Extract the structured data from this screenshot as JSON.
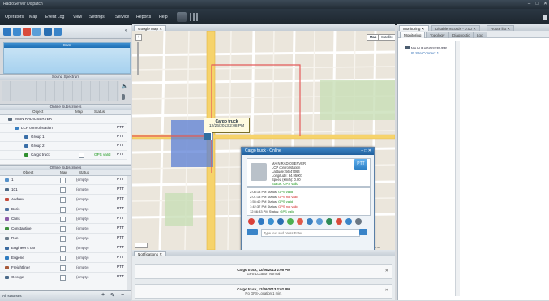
{
  "window": {
    "title": "RadioServer Dispatch"
  },
  "menu": [
    "Operators",
    "Map",
    "Event Log",
    "View",
    "Settings",
    "Service",
    "Reports",
    "Help"
  ],
  "panels": {
    "camera": "Cam",
    "spectrum": "Sound Spectrum",
    "online": "Online Subscribers",
    "offline": "Offline Subscribers"
  },
  "columns": {
    "object": "Object",
    "map": "Map",
    "status": "Status"
  },
  "online_rows": [
    {
      "name": "MAIN RADIOSERVER",
      "ptt": ""
    },
    {
      "name": "LCP control station",
      "ptt": "PTT"
    },
    {
      "name": "Group 1",
      "ptt": "PTT"
    },
    {
      "name": "Group 2",
      "ptt": "PTT"
    },
    {
      "name": "Cargo truck",
      "status": "GPS valid",
      "ptt": "PTT"
    }
  ],
  "offline_rows": [
    {
      "name": "1",
      "status": "(empty)",
      "ptt": "PTT"
    },
    {
      "name": "101",
      "status": "(empty)",
      "ptt": "PTT"
    },
    {
      "name": "Andrew",
      "status": "(empty)",
      "ptt": "PTT"
    },
    {
      "name": "Boris",
      "status": "(empty)",
      "ptt": "PTT"
    },
    {
      "name": "Chris",
      "status": "(empty)",
      "ptt": "PTT"
    },
    {
      "name": "Constantine",
      "status": "(empty)",
      "ptt": "PTT"
    },
    {
      "name": "Dan",
      "status": "(empty)",
      "ptt": "PTT"
    },
    {
      "name": "Engineer's car",
      "status": "(empty)",
      "ptt": "PTT"
    },
    {
      "name": "Eugene",
      "status": "(empty)",
      "ptt": "PTT"
    },
    {
      "name": "Freightliner",
      "status": "(empty)",
      "ptt": "PTT"
    },
    {
      "name": "George",
      "status": "(empty)",
      "ptt": "PTT"
    }
  ],
  "bottom": {
    "filter": "All statuses"
  },
  "map": {
    "tab": "Google Map",
    "type_map": "Map",
    "type_satellite": "Satellite",
    "tooltip_title": "Cargo truck",
    "tooltip_time": "12/26/2013 2:08 PM",
    "copyright": "Map data ©2013 Google · Terms of Use · Report a map error"
  },
  "dialog": {
    "title": "Cargo truck - Online",
    "info": [
      "MAIN RADIOSERVER",
      "LCP control station",
      "Latitude: 56.47064",
      "Longitude: 84.95007",
      "Speed (km/h): 0.00",
      "Status: GPS valid"
    ],
    "ptt": "PTT",
    "log": [
      {
        "time": "2:08:18 PM",
        "status": "GPS valid",
        "ok": true
      },
      {
        "time": "2:01:18 PM",
        "status": "GPS not valid",
        "ok": false
      },
      {
        "time": "1:55:40 PM",
        "status": "GPS valid",
        "ok": true
      },
      {
        "time": "1:42:37 PM",
        "status": "GPS not valid",
        "ok": false
      },
      {
        "time": "12:56:33 PM",
        "status": "GPS valid",
        "ok": true
      }
    ],
    "message_placeholder": "Type text and press Enter"
  },
  "notifications": {
    "tab": "Notifications",
    "items": [
      {
        "title": "Cargo truck, 12/26/2013 2:05 PM",
        "text": "GPS-Location Normal"
      },
      {
        "title": "Cargo truck, 12/26/2013 2:02 PM",
        "text": "No GPS-Location 1 min."
      }
    ]
  },
  "right": {
    "tabs": [
      "Monitoring",
      "Disable records - 0.00",
      "Route list"
    ],
    "subtabs": [
      "Monitoring",
      "Topology",
      "Diagnostic",
      "Log"
    ],
    "tree": [
      "MAIN RADIOSERVER",
      "IP Site Connect 1"
    ]
  },
  "colors": {
    "accent": "#2f79c2",
    "gps_valid": "#1f9a1f",
    "gps_invalid": "#cf2121"
  }
}
